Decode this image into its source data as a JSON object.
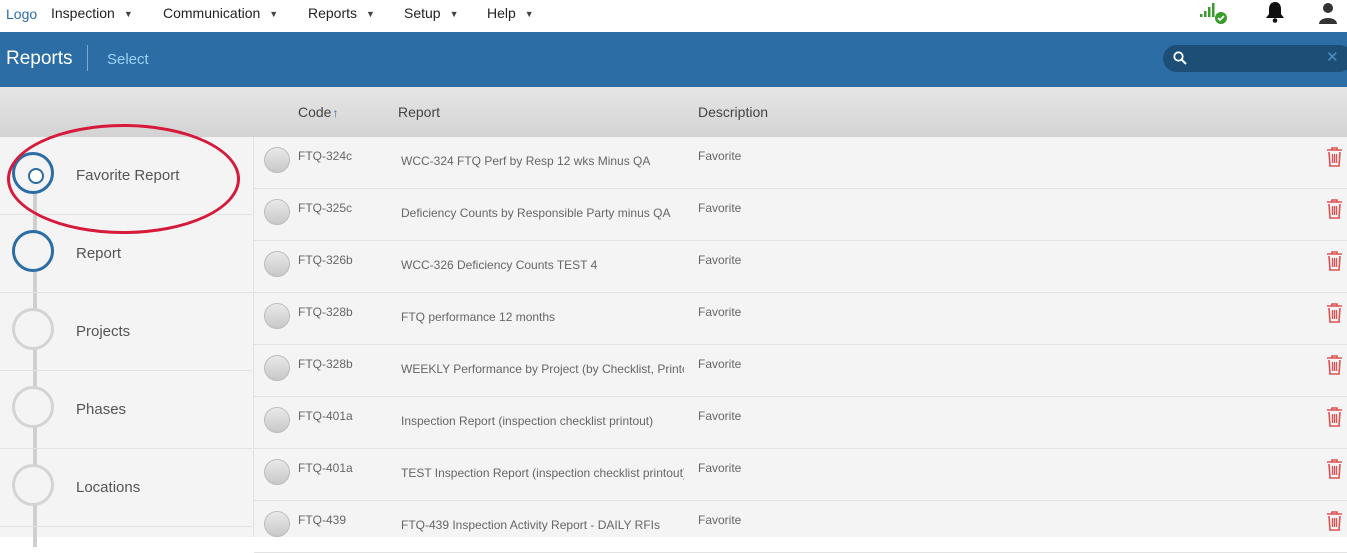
{
  "topnav": {
    "logo": "Logo",
    "menu": [
      {
        "label": "Inspection"
      },
      {
        "label": "Communication"
      },
      {
        "label": "Reports"
      },
      {
        "label": "Setup"
      },
      {
        "label": "Help"
      }
    ],
    "icons": [
      "signal-icon",
      "bell-icon",
      "user-icon"
    ],
    "signal_color": "#3a9b2d"
  },
  "header": {
    "title": "Reports",
    "select_label": "Select",
    "search_value": "",
    "clear_symbol": "✕",
    "bg_color": "#2b6da4"
  },
  "columns": {
    "code": "Code",
    "sort_arrow": "↑",
    "report": "Report",
    "description": "Description"
  },
  "steps": [
    {
      "label": "Favorite Report",
      "state": "current"
    },
    {
      "label": "Report",
      "state": "active"
    },
    {
      "label": "Projects",
      "state": "pending"
    },
    {
      "label": "Phases",
      "state": "pending"
    },
    {
      "label": "Locations",
      "state": "pending"
    }
  ],
  "rows": [
    {
      "code": "FTQ-324c",
      "report": "WCC-324  FTQ Perf by Resp 12 wks Minus QA",
      "description": "Favorite"
    },
    {
      "code": "FTQ-325c",
      "report": "Deficiency Counts by  Responsible Party minus QA",
      "description": "Favorite"
    },
    {
      "code": "FTQ-326b",
      "report": "WCC-326 Deficiency Counts  TEST 4",
      "description": "Favorite"
    },
    {
      "code": "FTQ-328b",
      "report": "FTQ performance 12 months",
      "description": "Favorite"
    },
    {
      "code": "FTQ-328b",
      "report": "WEEKLY Performance by Project (by Checklist, Printout)",
      "description": "Favorite"
    },
    {
      "code": "FTQ-401a",
      "report": "Inspection Report (inspection checklist printout)",
      "description": "Favorite"
    },
    {
      "code": "FTQ-401a",
      "report": "TEST Inspection Report (inspection checklist printout)",
      "description": "Favorite"
    },
    {
      "code": "FTQ-439",
      "report": "FTQ-439 Inspection Activity Report - DAILY RFIs",
      "description": "Favorite"
    }
  ],
  "colors": {
    "accent": "#2b6da4",
    "highlight": "#d7193a",
    "trash": "#e05050"
  }
}
